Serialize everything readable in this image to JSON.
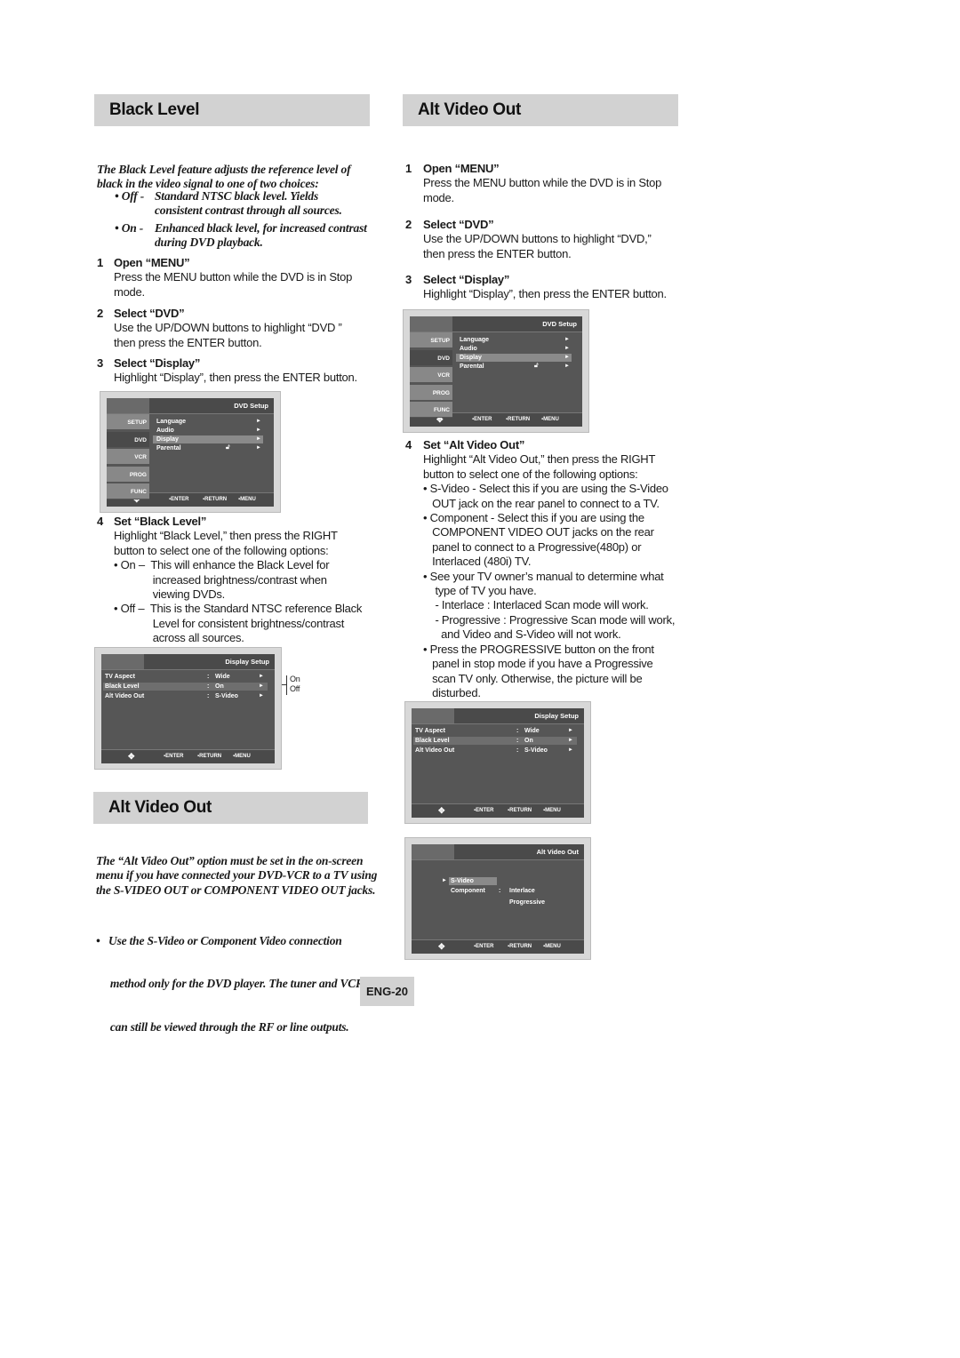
{
  "left": {
    "header1": "Black Level",
    "intro": [
      "The Black Level feature adjusts the reference level of",
      "black in the video signal to one of two choices:"
    ],
    "intro_bullets": [
      {
        "label": "• Off -",
        "lines": [
          "Standard NTSC black level. Yields",
          "consistent contrast through all sources."
        ]
      },
      {
        "label": "• On -",
        "lines": [
          "Enhanced black level, for increased contrast",
          "during DVD playback."
        ]
      }
    ],
    "steps": [
      {
        "num": "1",
        "title": "Open “MENU”",
        "lines": [
          "Press the MENU button while the DVD is in Stop",
          "mode."
        ]
      },
      {
        "num": "2",
        "title": "Select “DVD”",
        "lines": [
          "Use the UP/DOWN buttons to highlight “DVD ”",
          "then press the ENTER button."
        ]
      },
      {
        "num": "3",
        "title": "Select “Display”",
        "lines": [
          "Highlight “Display”, then press the ENTER button."
        ]
      },
      {
        "num": "4",
        "title": "Set “Black Level”",
        "lines": [
          "Highlight “Black Level,” then press the RIGHT",
          "button to select one of the following options:",
          "• On –  This will enhance the Black Level for",
          "             increased brightness/contrast when",
          "             viewing DVDs.",
          "• Off –  This is the Standard NTSC reference Black",
          "             Level for consistent brightness/contrast",
          "             across all sources."
        ]
      }
    ],
    "callout": [
      "On",
      "Off"
    ],
    "header2": "Alt Video Out",
    "intro2": [
      "The “Alt  Video Out” option must be set in the on-screen",
      "menu if you have connected your DVD-VCR to a TV using",
      "the S-VIDEO OUT or COMPONENT VIDEO OUT jacks."
    ],
    "bullet2": [
      "•   Use the S-Video or Component Video connection",
      "     method only for the DVD player. The tuner and VCR",
      "     can still be viewed through the RF or line outputs."
    ]
  },
  "right": {
    "header": "Alt Video Out",
    "steps": [
      {
        "num": "1",
        "title": "Open “MENU”",
        "lines": [
          "Press the MENU button while the DVD is in Stop",
          "mode."
        ]
      },
      {
        "num": "2",
        "title": "Select “DVD”",
        "lines": [
          "Use the UP/DOWN buttons to highlight “DVD,”",
          "then press the ENTER button."
        ]
      },
      {
        "num": "3",
        "title": "Select “Display”",
        "lines": [
          "Highlight “Display”, then press the ENTER button."
        ]
      },
      {
        "num": "4",
        "title": "Set “Alt Video Out”",
        "lines": [
          "Highlight “Alt Video Out,” then press the RIGHT",
          "button to select one of the following options:",
          "• S-Video - Select this if you are using the S-Video",
          "   OUT jack on the rear panel to connect to a TV.",
          "• Component - Select this if you are using the",
          "   COMPONENT VIDEO OUT jacks on the rear",
          "   panel to connect to a Progressive(480p) or",
          "   Interlaced (480i) TV.",
          "• See your TV owner’s manual to determine what",
          "    type of TV you have.",
          "    - Interlace : Interlaced Scan mode will work.",
          "    - Progressive : Progressive Scan mode will work,",
          "      and Video and S-Video will not work.",
          "• Press the PROGRESSIVE button on the front",
          "   panel in stop mode if you have a Progressive",
          "   scan TV only. Otherwise, the picture will be",
          "   disturbed."
        ]
      }
    ]
  },
  "screens": {
    "dvd_setup": {
      "title": "DVD Setup",
      "tabs": [
        "SETUP",
        "DVD",
        "VCR",
        "PROG",
        "FUNC"
      ],
      "selected_tab": 1,
      "items": [
        "Language",
        "Audio",
        "Display",
        "Parental"
      ],
      "highlight": 2
    },
    "display_setup": {
      "title": "Display Setup",
      "rows": [
        {
          "label": "TV Aspect",
          "value": "Wide"
        },
        {
          "label": "Black Level",
          "value": "On"
        },
        {
          "label": "Alt Video Out",
          "value": "S-Video"
        }
      ],
      "highlight": 1
    },
    "alt_video_out": {
      "title": "Alt Video Out",
      "options": [
        {
          "label": "S-Video"
        },
        {
          "label": "Component",
          "values": [
            "Interlace",
            "Progressive"
          ]
        }
      ],
      "highlight": 0
    },
    "footer": [
      "ENTER",
      "RETURN",
      "MENU"
    ],
    "arrow": "►"
  },
  "page_number": "ENG-20",
  "colors": {
    "header_bg": "#d2d2d2",
    "screen_bg": "#565656"
  }
}
